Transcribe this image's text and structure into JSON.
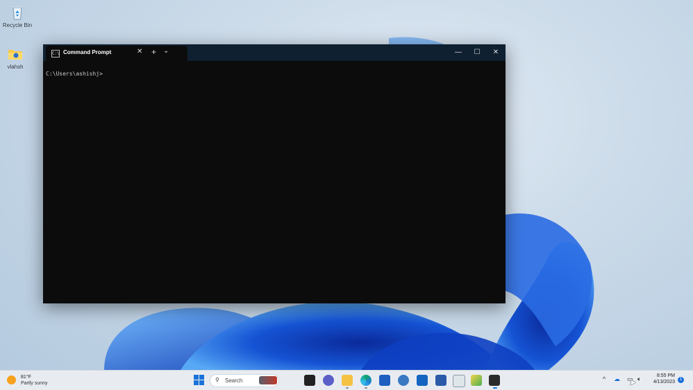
{
  "desktop": {
    "icons": [
      {
        "label": "Recycle Bin",
        "icon": "recycle-bin-icon"
      },
      {
        "label": "vlahsh",
        "icon": "folder-icon"
      }
    ]
  },
  "terminal": {
    "tab_title": "Command Prompt",
    "tab_icon": "cmd-icon",
    "new_tab_symbol": "+",
    "dropdown_symbol": "⌄",
    "close_tab_symbol": "✕",
    "minimize_symbol": "—",
    "maximize_symbol": "☐",
    "close_symbol": "✕",
    "prompt": "C:\\Users\\ashishj>"
  },
  "taskbar": {
    "weather": {
      "temp": "81°F",
      "condition": "Partly sunny",
      "icon": "weather-sun-icon"
    },
    "search_placeholder": "Search",
    "pinned": [
      "task-view-icon",
      "chat-icon",
      "file-explorer-icon",
      "edge-icon",
      "store-icon",
      "settings-icon",
      "outlook-icon",
      "powershell-icon",
      "notepad-icon",
      "paint-icon",
      "terminal-icon"
    ],
    "tray": {
      "chevron": "^",
      "time": "8:55 PM",
      "date": "4/13/2023",
      "notification_count": "1"
    }
  },
  "colors": {
    "terminal_bg": "#0c0c0c",
    "titlebar_bg": "#0f2031",
    "accent": "#1a73d9",
    "taskbar_bg": "#e8ecf1"
  }
}
